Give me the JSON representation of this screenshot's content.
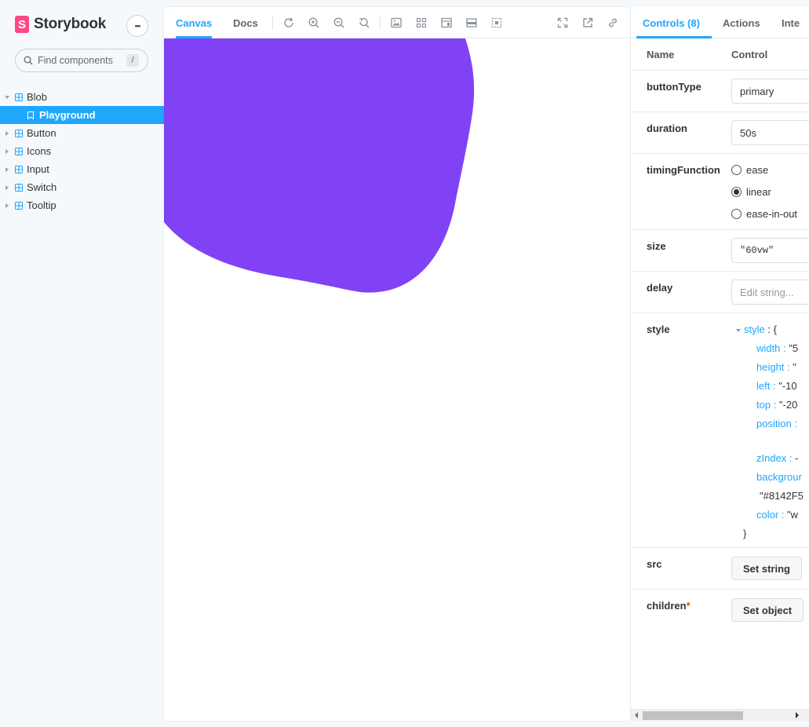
{
  "app": {
    "logo_letter": "S",
    "title": "Storybook",
    "menu_glyph": "•••"
  },
  "search": {
    "placeholder": "Find components",
    "shortcut": "/"
  },
  "sidebar": {
    "items": [
      {
        "label": "Blob"
      },
      {
        "label": "Playground"
      },
      {
        "label": "Button"
      },
      {
        "label": "Icons"
      },
      {
        "label": "Input"
      },
      {
        "label": "Switch"
      },
      {
        "label": "Tooltip"
      }
    ]
  },
  "preview": {
    "tabs": [
      "Canvas",
      "Docs"
    ],
    "blob_color": "#8142F5"
  },
  "addons": {
    "tabs": [
      "Controls (8)",
      "Actions",
      "Inte"
    ],
    "headers": {
      "name": "Name",
      "control": "Control"
    },
    "rows": {
      "buttonType": {
        "name": "buttonType",
        "value": "primary"
      },
      "duration": {
        "name": "duration",
        "value": "50s"
      },
      "timingFunction": {
        "name": "timingFunction",
        "options": [
          "ease",
          "linear",
          "ease-in-out"
        ],
        "selected": "linear"
      },
      "size": {
        "name": "size",
        "value": "\"60vw\""
      },
      "delay": {
        "name": "delay",
        "placeholder": "Edit string..."
      },
      "style": {
        "name": "style",
        "object_key": "style",
        "open": " : {",
        "entries": [
          {
            "key": "width",
            "value": "\"5"
          },
          {
            "key": "height",
            "value": "\""
          },
          {
            "key": "left",
            "value": "\"-10"
          },
          {
            "key": "top",
            "value": "\"-20"
          },
          {
            "key": "position",
            "value": ""
          },
          {
            "key": "zIndex",
            "value": "-"
          },
          {
            "key": "backgrour",
            "value": ""
          },
          {
            "key": "",
            "value": "\"#8142F5"
          },
          {
            "key": "color",
            "value": "\"w"
          }
        ],
        "close": "}"
      },
      "src": {
        "name": "src",
        "button": "Set string"
      },
      "children": {
        "name": "children",
        "required": "*",
        "button": "Set object"
      }
    }
  },
  "colors": {
    "accent": "#1EA7FD",
    "brand": "#FF4785",
    "blob": "#8142F5"
  }
}
